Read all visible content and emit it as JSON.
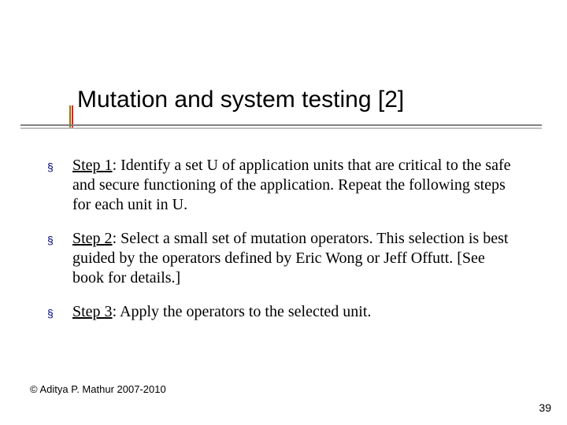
{
  "title": "Mutation and system testing [2]",
  "bullets": [
    {
      "label": "Step 1",
      "rest": ": Identify a set U of application units that are critical to the safe and secure functioning of the application. Repeat the following steps for each unit in U."
    },
    {
      "label": "Step 2",
      "rest": ": Select a small set of mutation operators. This selection is best guided by the operators defined by Eric Wong or Jeff Offutt. [See book for details.]"
    },
    {
      "label": "Step 3",
      "rest": ": Apply the operators to the selected unit."
    }
  ],
  "footer_left": "© Aditya P. Mathur 2007-2010",
  "page_number": "39",
  "bullet_glyph": "§"
}
